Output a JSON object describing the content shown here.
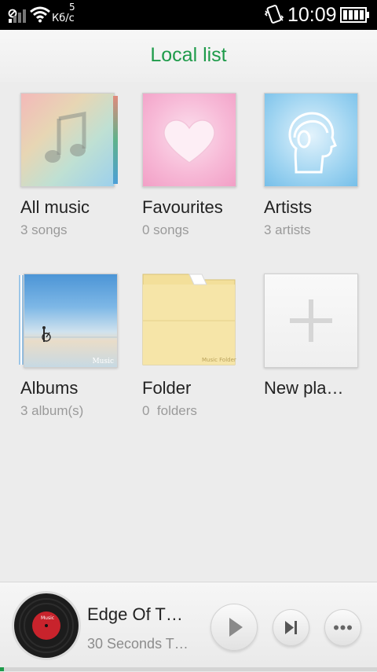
{
  "status_bar": {
    "net_count": "5",
    "net_speed": "Кб/с",
    "time": "10:09"
  },
  "header": {
    "title": "Local list"
  },
  "tiles": [
    {
      "label": "All music",
      "sub": "3 songs"
    },
    {
      "label": "Favourites",
      "sub": "0 songs"
    },
    {
      "label": "Artists",
      "sub": "3 artists"
    },
    {
      "label": "Albums",
      "sub": "3 album(s)",
      "cover_text": "Music"
    },
    {
      "label": "Folder",
      "sub": "0  folders",
      "cover_text": "Music Folder"
    },
    {
      "label": "New pla…"
    }
  ],
  "player": {
    "disc_label": "Music",
    "track": "Edge Of T…",
    "artist": "30 Seconds T…",
    "progress": 0.01
  },
  "colors": {
    "accent": "#1e9b4a"
  }
}
